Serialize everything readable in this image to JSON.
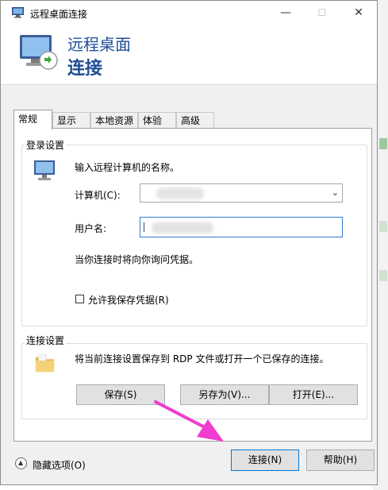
{
  "window": {
    "title": "远程桌面连接",
    "minimize_glyph": "—",
    "maximize_glyph": "☐",
    "close_glyph": "✕"
  },
  "banner": {
    "line1": "远程桌面",
    "line2": "连接"
  },
  "tabs": [
    {
      "label": "常规",
      "active": true
    },
    {
      "label": "显示"
    },
    {
      "label": "本地资源"
    },
    {
      "label": "体验"
    },
    {
      "label": "高级"
    }
  ],
  "login": {
    "group_label": "登录设置",
    "instruction": "输入远程计算机的名称。",
    "computer_label": "计算机(C):",
    "computer_value": "",
    "username_label": "用户名:",
    "username_value": "",
    "prompt_note": "当你连接时将向你询问凭据。",
    "save_credentials_label": "允许我保存凭据(R)",
    "save_credentials_checked": false
  },
  "connection": {
    "group_label": "连接设置",
    "description": "将当前连接设置保存到 RDP 文件或打开一个已保存的连接。",
    "save_button": "保存(S)",
    "save_as_button": "另存为(V)...",
    "open_button": "打开(E)..."
  },
  "footer": {
    "hide_options_label": "隐藏选项(O)",
    "connect_button": "连接(N)",
    "help_button": "帮助(H)"
  },
  "icons": {
    "title": "remote-desktop-icon",
    "banner": "remote-desktop-icon",
    "login": "computer-monitor-icon",
    "connection": "folder-icon",
    "footer_toggle": "chevron-up-icon"
  },
  "colors": {
    "banner_text": "#1f4e96",
    "annotation_arrow": "#f03ccf",
    "focus_border": "#0078d7"
  }
}
